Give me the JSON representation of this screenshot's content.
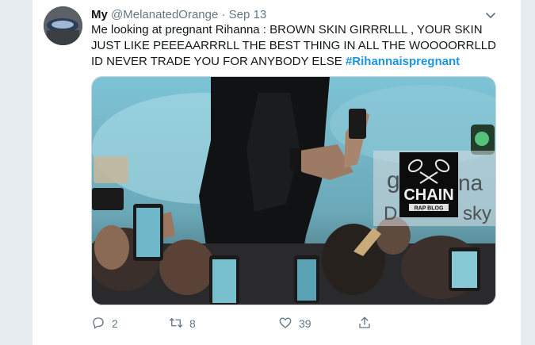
{
  "tweet": {
    "display_name": "My",
    "handle": "@MelanatedOrange",
    "separator": "·",
    "date": "Sep 13",
    "text": "Me looking at pregnant Rihanna : BROWN SKIN GIRRRLLL , YOUR SKIN JUST LIKE PEEEAARRRLL THE BEST THING IN ALL THE WOOOORRLLD ID NEVER TRADE YOU FOR ANYBODY ELSE ",
    "hashtag": "#Rihannaispregnant",
    "media": {
      "watermark_line1": "CHAIN",
      "watermark_line2": "RAP BLOG",
      "overlay_text_1": "g",
      "overlay_text_2": "na",
      "overlay_text_3": "D",
      "overlay_text_4": "sky"
    },
    "actions": {
      "reply_count": "2",
      "retweet_count": "8",
      "like_count": "39"
    }
  },
  "icons": [
    "avatar",
    "chevron-down-icon",
    "reply-icon",
    "retweet-icon",
    "heart-icon",
    "share-icon"
  ],
  "colors": {
    "accent": "#1b95e0",
    "muted": "#657786",
    "text": "#14171a",
    "background": "#e6ecf0"
  }
}
